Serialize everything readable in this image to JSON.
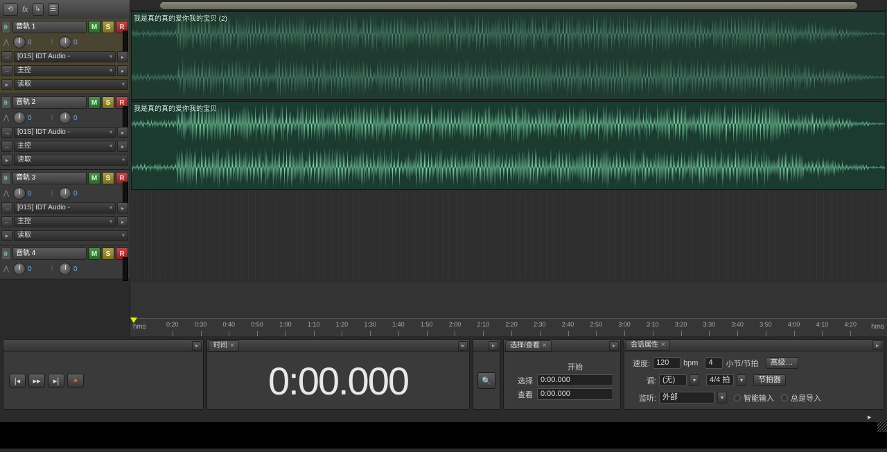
{
  "topbar": {
    "fx_label": "fx"
  },
  "tracks": [
    {
      "name": "音轨 1",
      "m": "M",
      "s": "S",
      "r": "R",
      "vol": "0",
      "pan": "0",
      "io": "[01S] IDT Audio -",
      "send": "主控",
      "auto": "读取",
      "selected": true,
      "lane": "wave",
      "clip": "我是真的真的爱你我的宝贝 (2)"
    },
    {
      "name": "音轨 2",
      "m": "M",
      "s": "S",
      "r": "R",
      "vol": "0",
      "pan": "0",
      "io": "[01S] IDT Audio -",
      "send": "主控",
      "auto": "读取",
      "selected": false,
      "lane": "wave",
      "clip": "我是真的真的爱你我的宝贝"
    },
    {
      "name": "音轨 3",
      "m": "M",
      "s": "S",
      "r": "R",
      "vol": "0",
      "pan": "0",
      "io": "[01S] IDT Audio -",
      "send": "主控",
      "auto": "读取",
      "selected": false,
      "lane": "empty"
    },
    {
      "name": "音轨 4",
      "m": "M",
      "s": "S",
      "r": "R",
      "vol": "0",
      "pan": "0",
      "selected": false,
      "lane": "none"
    }
  ],
  "ruler": {
    "unit": "hms",
    "ticks": [
      "0:20",
      "0:30",
      "0:40",
      "0:50",
      "1:00",
      "1:10",
      "1:20",
      "1:30",
      "1:40",
      "1:50",
      "2:00",
      "2:10",
      "2:20",
      "2:30",
      "2:40",
      "2:50",
      "3:00",
      "3:10",
      "3:20",
      "3:30",
      "3:40",
      "3:50",
      "4:00",
      "4:10",
      "4:20"
    ]
  },
  "time_panel": {
    "title": "时间",
    "value": "0:00.000"
  },
  "selection_panel": {
    "title": "选择/查看",
    "start_label": "开始",
    "row1_label": "选择",
    "row1_val": "0:00.000",
    "row2_label": "查看",
    "row2_val": "0:00.000"
  },
  "session_panel": {
    "title": "会话属性",
    "tempo_label": "速度:",
    "tempo_val": "120",
    "tempo_unit": "bpm",
    "beats_val": "4",
    "beats_label": "小节/节拍",
    "adv_label": "高级…",
    "key_label": "调:",
    "key_val": "(无)",
    "sig_val": "4/4 拍",
    "metronome": "节拍器",
    "monitor_label": "监听:",
    "monitor_val": "外部",
    "smart_in": "智能输入",
    "always_in": "总是导入"
  },
  "colors": {
    "wave_bright": "#6fe8b5",
    "wave_dim": "#4f8f72"
  }
}
